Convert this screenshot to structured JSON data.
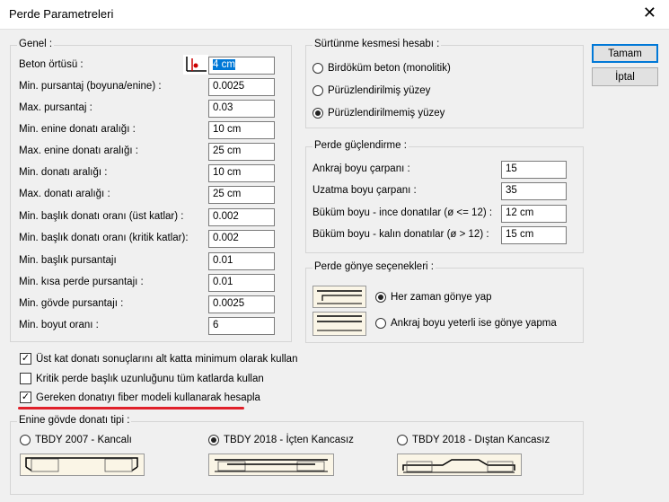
{
  "window": {
    "title": "Perde Parametreleri"
  },
  "buttons": {
    "ok": "Tamam",
    "cancel": "İptal"
  },
  "genel": {
    "title": "Genel :",
    "rows": [
      {
        "label": "Beton örtüsü :",
        "value": "4 cm"
      },
      {
        "label": "Min. pursantaj (boyuna/enine) :",
        "value": "0.0025"
      },
      {
        "label": "Max. pursantaj :",
        "value": "0.03"
      },
      {
        "label": "Min. enine donatı aralığı :",
        "value": "10 cm"
      },
      {
        "label": "Max. enine donatı aralığı :",
        "value": "25 cm"
      },
      {
        "label": "Min. donatı aralığı :",
        "value": "10 cm"
      },
      {
        "label": "Max. donatı aralığı :",
        "value": "25 cm"
      },
      {
        "label": "Min. başlık donatı oranı (üst katlar) :",
        "value": "0.002"
      },
      {
        "label": "Min. başlık donatı oranı (kritik katlar):",
        "value": "0.002"
      },
      {
        "label": "Min. başlık pursantajı",
        "value": "0.01"
      },
      {
        "label": "Min. kısa perde pursantajı :",
        "value": "0.01"
      },
      {
        "label": "Min. gövde pursantajı :",
        "value": "0.0025"
      },
      {
        "label": "Min. boyut oranı :",
        "value": "6"
      }
    ]
  },
  "checks": [
    {
      "label": "Üst kat donatı sonuçlarını alt katta minimum olarak kullan",
      "checked": true
    },
    {
      "label": "Kritik perde başlık uzunluğunu tüm katlarda kullan",
      "checked": false
    },
    {
      "label": "Gereken donatıyı fiber modeli kullanarak hesapla",
      "checked": true
    }
  ],
  "surtunme": {
    "title": "Sürtünme kesmesi hesabı :",
    "options": [
      {
        "label": "Birdöküm beton (monolitik)",
        "selected": false
      },
      {
        "label": "Pürüzlendirilmiş yüzey",
        "selected": false
      },
      {
        "label": "Pürüzlendirilmemiş yüzey",
        "selected": true
      }
    ]
  },
  "guclendirme": {
    "title": "Perde güçlendirme :",
    "rows": [
      {
        "label": "Ankraj boyu çarpanı :",
        "value": "15"
      },
      {
        "label": "Uzatma boyu çarpanı :",
        "value": "35"
      },
      {
        "label": "Büküm boyu - ince donatılar (ø <= 12) :",
        "value": "12 cm"
      },
      {
        "label": "Büküm boyu - kalın donatılar (ø > 12) :",
        "value": "15 cm"
      }
    ]
  },
  "gonye": {
    "title": "Perde gönye seçenekleri :",
    "options": [
      {
        "label": "Her zaman gönye yap",
        "selected": true
      },
      {
        "label": "Ankraj boyu yeterli ise gönye yapma",
        "selected": false
      }
    ]
  },
  "govde": {
    "title": "Enine gövde donatı tipi :",
    "options": [
      {
        "label": "TBDY 2007 - Kancalı",
        "selected": false
      },
      {
        "label": "TBDY 2018 - İçten Kancasız",
        "selected": true
      },
      {
        "label": "TBDY 2018 - Dıştan Kancasız",
        "selected": false
      }
    ]
  },
  "colors": {
    "accent": "#0078d7",
    "annotation": "#e0202a",
    "drawing_bg": "#faf5e6"
  }
}
